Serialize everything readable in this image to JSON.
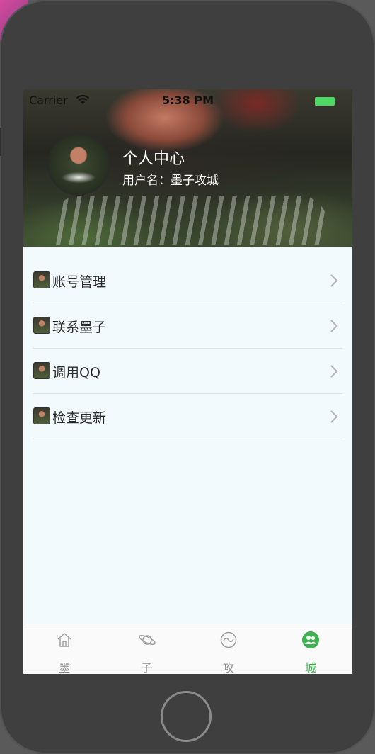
{
  "status_bar": {
    "carrier": "Carrier",
    "time": "5:38 PM"
  },
  "profile": {
    "title": "个人中心",
    "username": "用户名：墨子攻城"
  },
  "menu": {
    "items": [
      {
        "label": "账号管理"
      },
      {
        "label": "联系墨子"
      },
      {
        "label": "调用QQ"
      },
      {
        "label": "检查更新"
      }
    ]
  },
  "tabbar": {
    "tabs": [
      {
        "label": "墨",
        "icon": "home-icon",
        "active": false
      },
      {
        "label": "子",
        "icon": "planet-icon",
        "active": false
      },
      {
        "label": "攻",
        "icon": "wave-icon",
        "active": false
      },
      {
        "label": "城",
        "icon": "people-icon",
        "active": true
      }
    ]
  },
  "colors": {
    "accent": "#3fb24f",
    "battery": "#4cd964",
    "background": "#f3fafe"
  }
}
